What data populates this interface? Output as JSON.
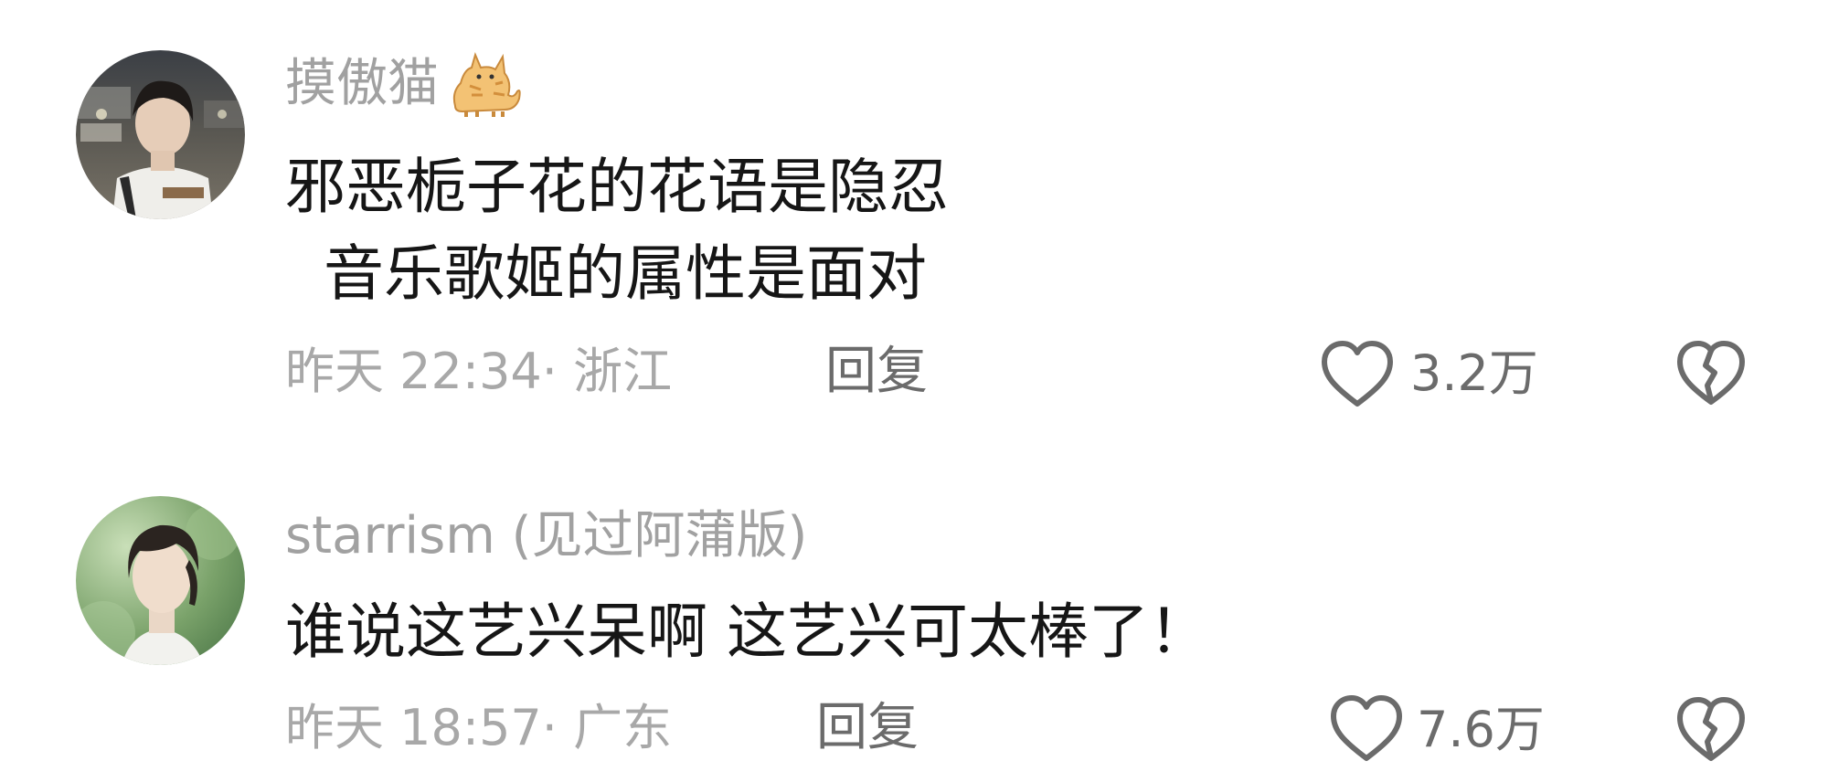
{
  "comments": [
    {
      "username": "摸傲猫",
      "username_emoji": "cat-icon",
      "text_lines": [
        "邪恶栀子花的花语是隐忍",
        "  音乐歌姬的属性是面对"
      ],
      "meta": "昨天 22:34· 浙江",
      "reply_label": "回复",
      "likes": "3.2万"
    },
    {
      "username": "starrism (见过阿蒲版)",
      "text_lines": [
        "谁说这艺兴呆啊 这艺兴可太棒了！"
      ],
      "meta": "昨天 18:57· 广东",
      "reply_label": "回复",
      "likes": "7.6万"
    }
  ],
  "icons": {
    "like": "heart-outline-icon",
    "dislike": "broken-heart-icon"
  },
  "colors": {
    "username": "#a1a1a1",
    "body_text": "#161616",
    "meta": "#a8a8a8",
    "action": "#6b6b6b"
  }
}
